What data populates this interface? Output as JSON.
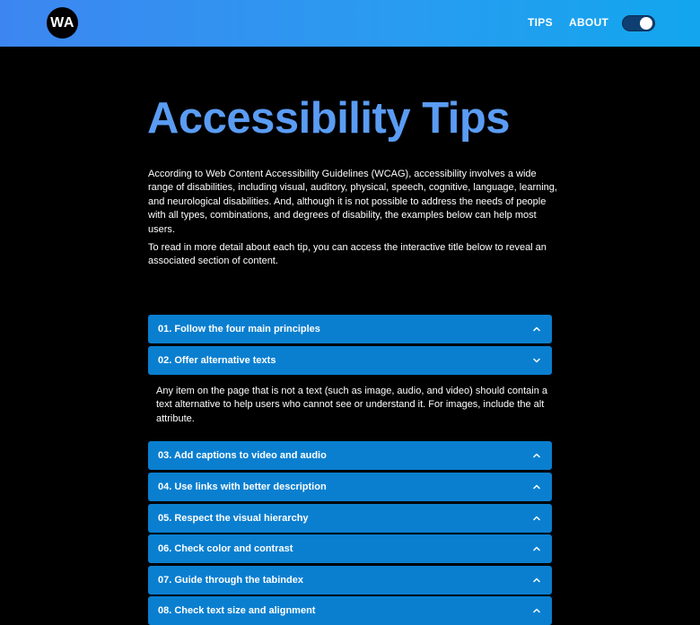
{
  "header": {
    "logo_text": "WA",
    "nav": [
      "TIPS",
      "ABOUT"
    ],
    "theme_toggle": {
      "state": "on"
    }
  },
  "main": {
    "title": "Accessibility Tips",
    "intro": "According to Web Content Accessibility Guidelines (WCAG), accessibility involves a wide range of disabilities, including visual, auditory, physical, speech, cognitive, language, learning, and neurological disabilities. And, although it is not possible to address the needs of people with all types, combinations, and degrees of disability, the examples below can help most users.",
    "instructions": "To read in more detail about each tip, you can access the interactive title below to reveal an associated section of content.",
    "tips": [
      {
        "label": "01. Follow the four main principles",
        "expanded": false
      },
      {
        "label": "02. Offer alternative texts",
        "expanded": true,
        "content": "Any item on the page that is not a text (such as image, audio, and video) should contain a text alternative to help users who cannot see or understand it. For images, include the alt attribute."
      },
      {
        "label": "03. Add captions to video and audio",
        "expanded": false
      },
      {
        "label": "04. Use links with better description",
        "expanded": false
      },
      {
        "label": "05. Respect the visual hierarchy",
        "expanded": false
      },
      {
        "label": "06. Check color and contrast",
        "expanded": false
      },
      {
        "label": "07. Guide through the tabindex",
        "expanded": false
      },
      {
        "label": "08. Check text size and alignment",
        "expanded": false
      }
    ]
  },
  "colors": {
    "header_gradient": [
      "#3d86f1",
      "#12a6ee"
    ],
    "title": "#5a9cf3",
    "accordion": "#0a7fd0",
    "background": "#000000"
  }
}
